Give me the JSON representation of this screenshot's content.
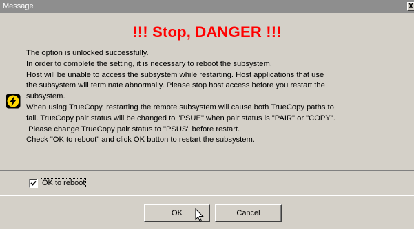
{
  "window": {
    "title": "Message",
    "close_label": "X"
  },
  "heading": "!!! Stop, DANGER !!!",
  "message_lines": [
    "The option is unlocked successfully.",
    "In order to complete the setting, it is necessary to reboot the subsystem.",
    "Host will be unable to access the subsystem while restarting. Host applications that use",
    "the subsystem will terminate abnormally. Please stop host access before you restart the",
    "subsystem.",
    "When using TrueCopy, restarting the remote subsystem will cause both TrueCopy paths to",
    "fail. TrueCopy pair status will be changed to \"PSUE\" when pair status is \"PAIR\" or \"COPY\".",
    " Please change TrueCopy pair status to \"PSUS\" before restart.",
    "Check \"OK to reboot\" and click OK button to restart the subsystem."
  ],
  "checkbox": {
    "label": "OK to reboot",
    "checked": true
  },
  "buttons": {
    "ok_label": "OK",
    "cancel_label": "Cancel"
  },
  "icons": {
    "warning": "warning-lightning-icon",
    "cursor": "mouse-pointer-icon"
  },
  "colors": {
    "heading": "#ff0000",
    "titlebar": "#8e8e8e",
    "dialog_bg": "#d4d0c8"
  }
}
